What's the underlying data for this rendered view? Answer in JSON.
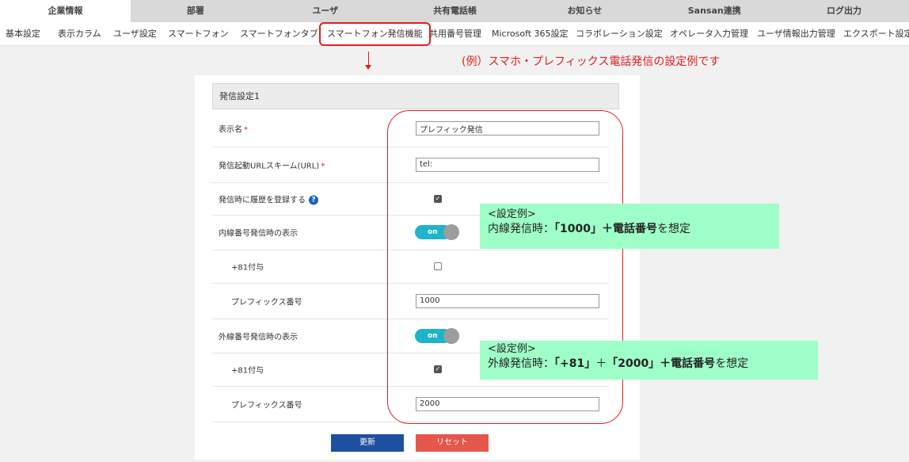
{
  "top_tabs": [
    "企業情報",
    "部署",
    "ユーザ",
    "共有電話帳",
    "お知らせ",
    "Sansan連携",
    "ログ出力"
  ],
  "sub_nav": [
    "基本設定",
    "表示カラム",
    "ユーザ設定",
    "スマートフォン",
    "スマートフォンタブ",
    "スマートフォン発信機能",
    "共用番号管理",
    "Microsoft 365設定",
    "コラボレーション設定",
    "オペレータ入力管理",
    "ユーザ情報出力管理",
    "エクスポート設定"
  ],
  "annotation": {
    "note": "(例）スマホ・プレフィックス電話発信の設定例です"
  },
  "form": {
    "section_title": "発信設定1",
    "display_name_label": "表示名",
    "display_name_value": "プレフィック発信",
    "url_scheme_label": "発信起動URLスキーム(URL)",
    "url_scheme_value": "tel:",
    "register_history_label": "発信時に履歴を登録する",
    "register_history_checked": true,
    "internal_label": "内線番号発信時の表示",
    "internal_toggle": "on",
    "internal_plus81_label": "+81付与",
    "internal_plus81_checked": false,
    "internal_prefix_label": "プレフィックス番号",
    "internal_prefix_value": "1000",
    "external_label": "外線番号発信時の表示",
    "external_toggle": "on",
    "external_plus81_label": "+81付与",
    "external_plus81_checked": true,
    "external_prefix_label": "プレフィックス番号",
    "external_prefix_value": "2000",
    "required_mark": "*",
    "help_icon": "?",
    "update_button": "更新",
    "reset_button": "リセット"
  },
  "examples": [
    {
      "title": "<設定例>",
      "prefix": "内線発信時：",
      "bold1": "「1000」＋電話番号",
      "suffix": "を想定"
    },
    {
      "title": "<設定例>",
      "prefix": "外線発信時：",
      "bold1": "「+81」",
      "mid": "＋",
      "bold2": "「2000」＋電話番号",
      "suffix": "を想定"
    }
  ],
  "colors": {
    "accent_red": "#e02020",
    "toggle": "#1fb5c9",
    "update_button": "#1f4fa0",
    "reset_button": "#e4574a",
    "example_bg": "#9effc8"
  }
}
